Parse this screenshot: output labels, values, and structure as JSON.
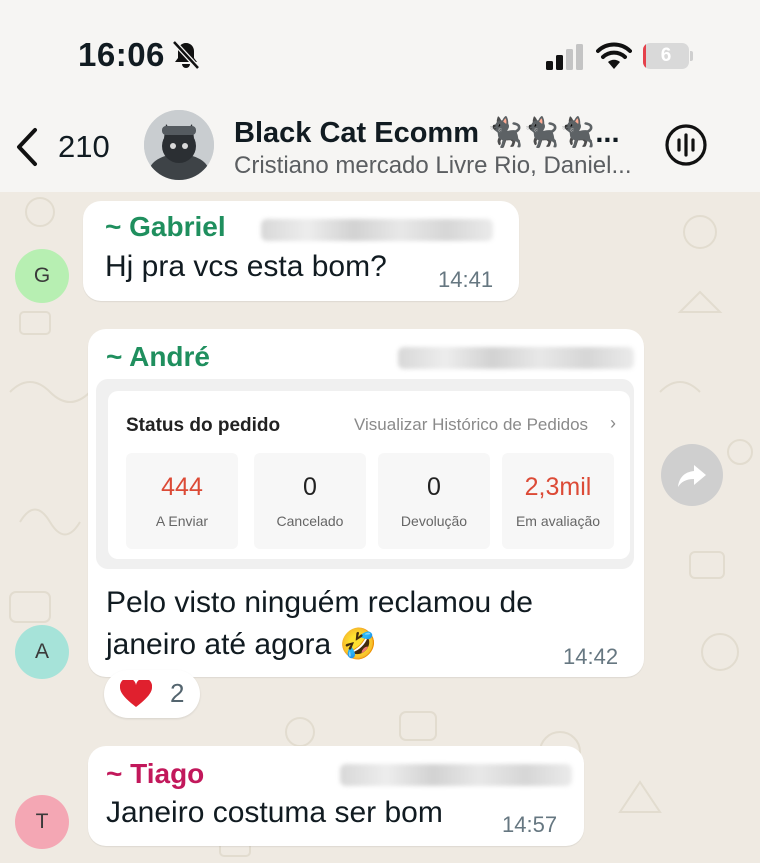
{
  "status_bar": {
    "time": "16:06",
    "battery_level": "6",
    "battery_fraction": 0.06,
    "battery_color": "#e5414b",
    "icons": [
      "bell-off-icon",
      "cellular-signal-icon",
      "wifi-icon",
      "battery-icon"
    ]
  },
  "header": {
    "back_count": "210",
    "title": "Black Cat Ecomm 🐈‍⬛🐈‍⬛🐈‍⬛...",
    "subtitle": "Cristiano mercado Livre Rio, Daniel...",
    "icons": [
      "chevron-left-icon",
      "group-avatar",
      "voice-call-icon"
    ]
  },
  "messages": [
    {
      "sender": "~ Gabriel",
      "sender_color": "#1f8f5e",
      "avatar_letter": "G",
      "avatar_color": "#b7efb2",
      "text": "Hj pra vcs esta bom?",
      "time": "14:41"
    },
    {
      "sender": "~ André",
      "sender_color": "#1f8f5e",
      "avatar_letter": "A",
      "avatar_color": "#a6e3d9",
      "order_status": {
        "title": "Status do pedido",
        "link": "Visualizar Histórico de Pedidos",
        "stats": [
          {
            "value": "444",
            "label": "A Enviar",
            "color": "#dc4a36"
          },
          {
            "value": "0",
            "label": "Cancelado",
            "color": "#222222"
          },
          {
            "value": "0",
            "label": "Devolução",
            "color": "#222222"
          },
          {
            "value": "2,3mil",
            "label": "Em avaliação",
            "color": "#dc4a36"
          }
        ]
      },
      "text_line1": "Pelo visto ninguém reclamou de",
      "text_line2": "janeiro até agora 🤣",
      "time": "14:42",
      "reaction": {
        "emoji": "heart",
        "count": "2"
      }
    },
    {
      "sender": "~ Tiago",
      "sender_color": "#c2185b",
      "avatar_letter": "T",
      "avatar_color": "#f4a7b4",
      "text": "Janeiro costuma ser bom",
      "time": "14:57"
    }
  ]
}
